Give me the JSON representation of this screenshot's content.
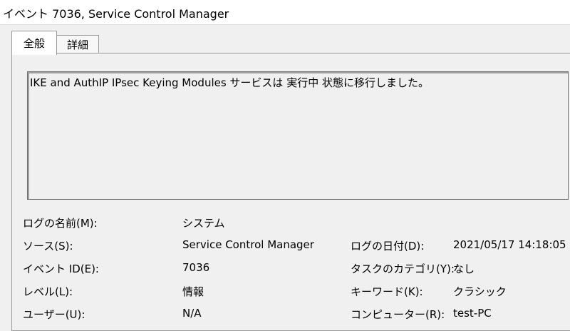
{
  "window": {
    "title": "イベント 7036, Service Control Manager"
  },
  "tabs": [
    {
      "label": "全般",
      "active": true
    },
    {
      "label": "詳細",
      "active": false
    }
  ],
  "description": "IKE and AuthIP IPsec Keying Modules サービスは 実行中 状態に移行しました。",
  "fields": {
    "log_name": {
      "label": "ログの名前(M):",
      "value": "システム"
    },
    "source": {
      "label": "ソース(S):",
      "value": "Service Control Manager"
    },
    "logged": {
      "label": "ログの日付(D):",
      "value": "2021/05/17 14:18:05"
    },
    "event_id": {
      "label": "イベント ID(E):",
      "value": "7036"
    },
    "task_category": {
      "label": "タスクのカテゴリ(Y):",
      "value": "なし"
    },
    "level": {
      "label": "レベル(L):",
      "value": "情報"
    },
    "keywords": {
      "label": "キーワード(K):",
      "value": "クラシック"
    },
    "user": {
      "label": "ユーザー(U):",
      "value": "N/A"
    },
    "computer": {
      "label": "コンピューター(R):",
      "value": "test-PC"
    }
  }
}
